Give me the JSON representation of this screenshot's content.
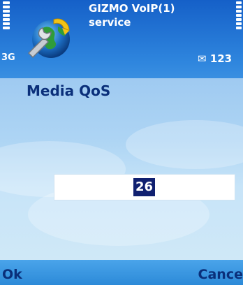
{
  "status": {
    "app_title_line1": "GIZMO VoIP(1)",
    "app_title_line2": "service",
    "network": "3G",
    "mail_count": "123",
    "app_icon": "gizmo-voip-icon"
  },
  "dialog": {
    "title": "Media QoS",
    "value": "26"
  },
  "softkeys": {
    "left": "Ok",
    "right": "Cance"
  },
  "colors": {
    "status_bg": "#2f86de",
    "dialog_bg": "#aed5f4",
    "text_dark": "#0a2f7a",
    "selection": "#102070"
  }
}
